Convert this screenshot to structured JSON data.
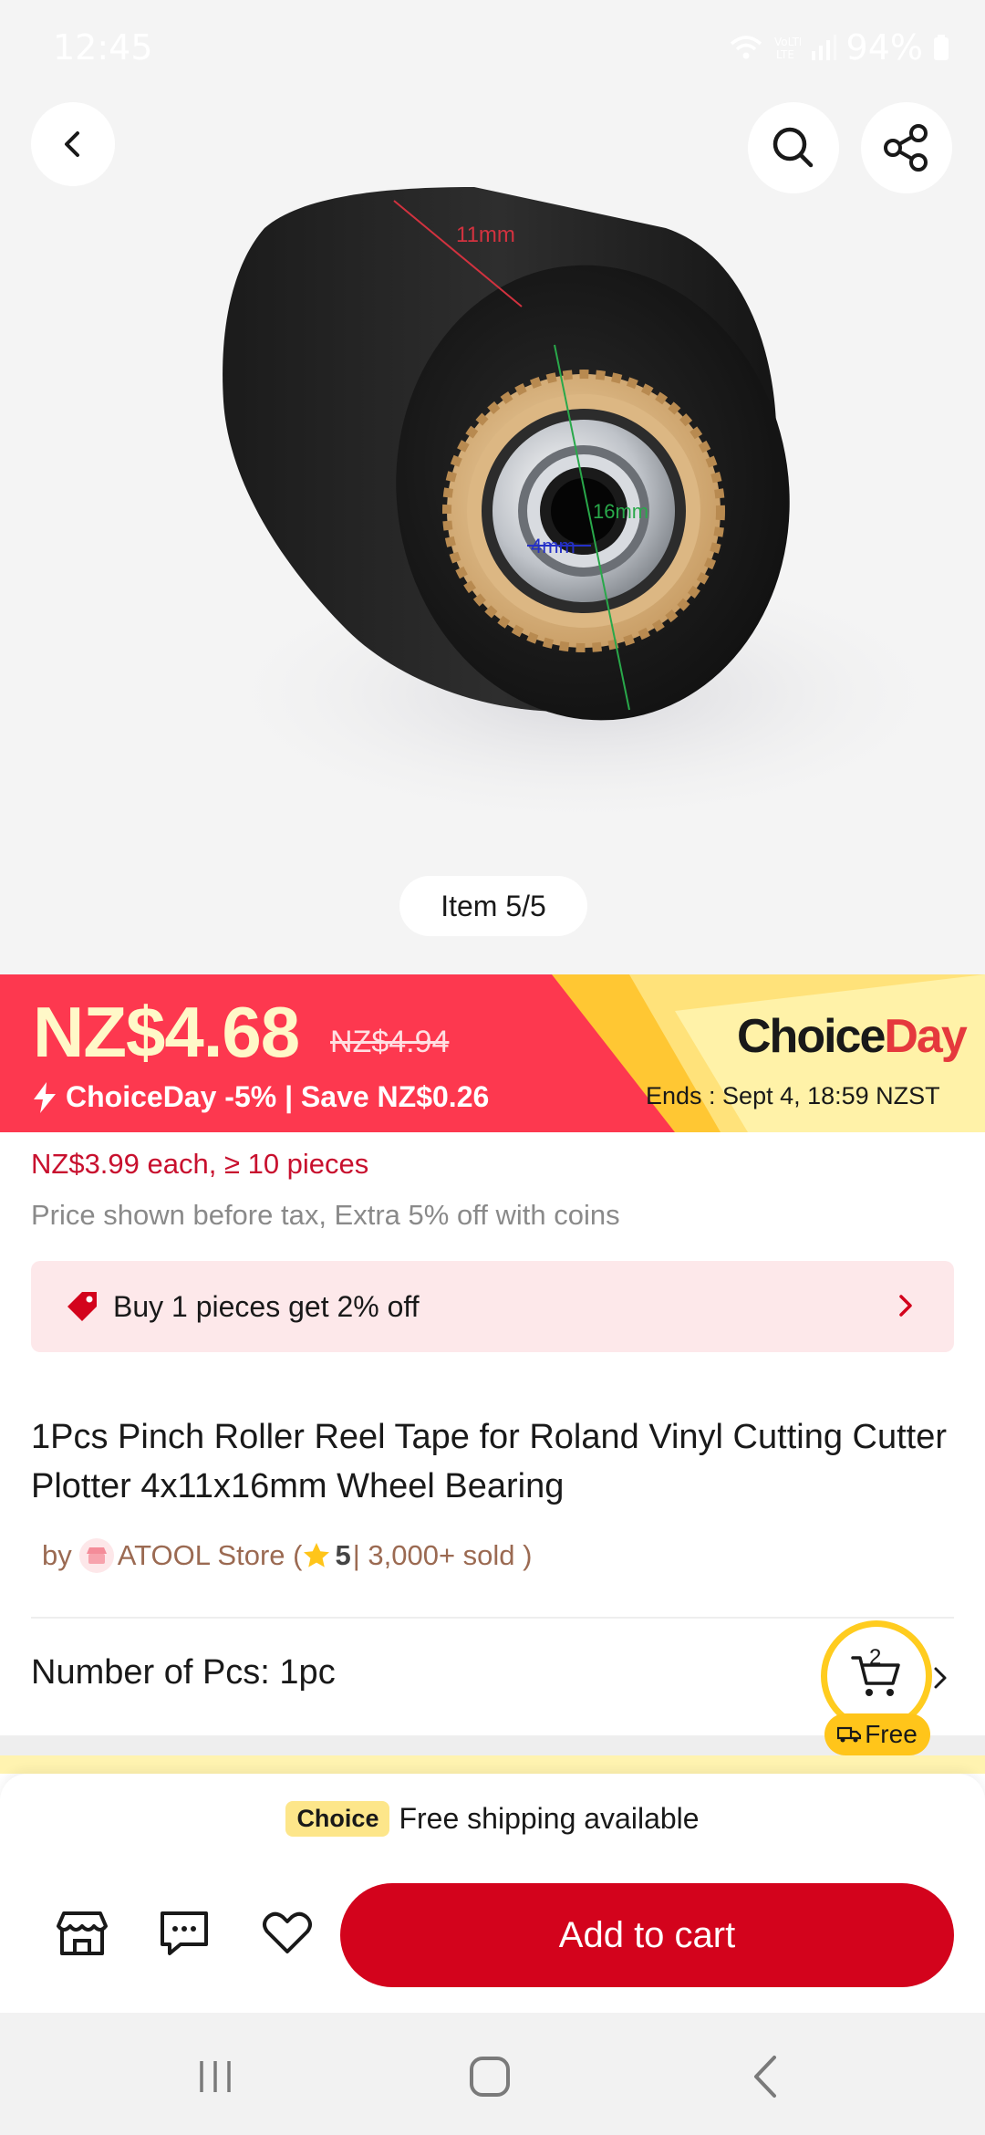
{
  "status_bar": {
    "time": "12:45",
    "battery": "94%",
    "icons": [
      "wifi-icon",
      "volte-icon",
      "signal-icon",
      "battery-icon"
    ]
  },
  "gallery": {
    "counter": "Item 5/5",
    "dimension_labels": [
      "11mm",
      "16mm",
      "4mm"
    ]
  },
  "price": {
    "current": "NZ$4.68",
    "original": "NZ$4.94",
    "choiceday_text": "ChoiceDay -5% | Save NZ$0.26",
    "brand_choice": "Choice",
    "brand_day": "Day",
    "ends": "Ends :  Sept 4, 18:59 NZST",
    "colors": {
      "banner": "#fd384f",
      "price": "#fff8c8",
      "choice_yellow": "#ffc733"
    }
  },
  "bulk_price": "NZ$3.99 each, ≥ 10 pieces",
  "tax_note": "Price shown before tax, Extra 5% off with coins",
  "promo": {
    "text": "Buy 1 pieces get 2% off"
  },
  "product": {
    "title": "1Pcs Pinch Roller Reel Tape for Roland Vinyl Cutting Cutter Plotter 4x11x16mm Wheel Bearing"
  },
  "store": {
    "by": "by",
    "name": "ATOOL Store (",
    "rating": "5",
    "sold": "| 3,000+ sold )"
  },
  "variant": {
    "label": "Number of Pcs: 1pc"
  },
  "cart": {
    "count": "2",
    "free_label": "Free"
  },
  "bottom": {
    "choice_badge": "Choice",
    "shipping": "Free shipping available",
    "add_to_cart": "Add to cart"
  }
}
